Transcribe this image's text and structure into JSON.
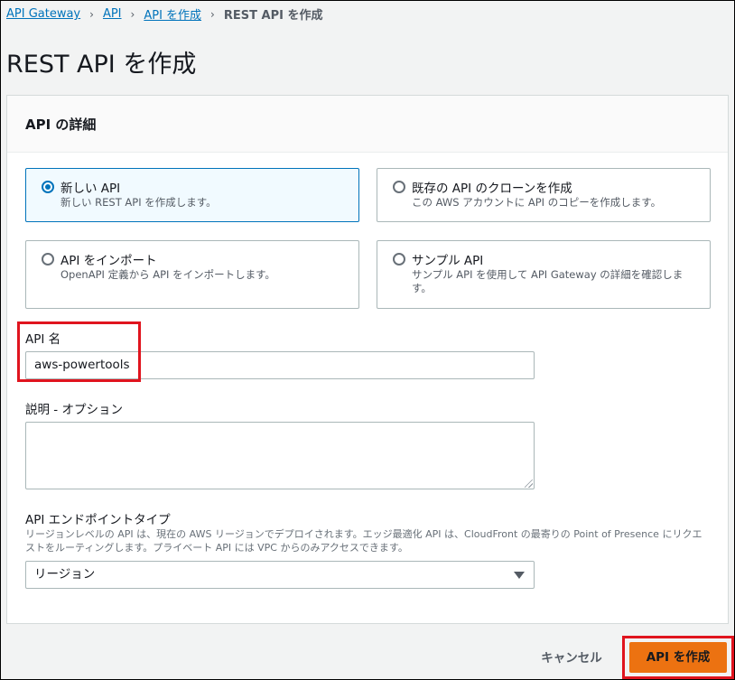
{
  "breadcrumb": {
    "items": [
      "API Gateway",
      "API",
      "API を作成"
    ],
    "current": "REST API を作成",
    "separator": "›"
  },
  "page_title": "REST API を作成",
  "panel": {
    "title": "API の詳細"
  },
  "options": [
    {
      "title": "新しい API",
      "description": "新しい REST API を作成します。",
      "selected": true
    },
    {
      "title": "既存の API のクローンを作成",
      "description": "この AWS アカウントに API のコピーを作成します。",
      "selected": false
    },
    {
      "title": "API をインポート",
      "description": "OpenAPI 定義から API をインポートします。",
      "selected": false
    },
    {
      "title": "サンプル API",
      "description": "サンプル API を使用して API Gateway の詳細を確認します。",
      "selected": false
    }
  ],
  "api_name": {
    "label": "API 名",
    "value": "aws-powertools"
  },
  "description_field": {
    "label": "説明 - オプション",
    "value": ""
  },
  "endpoint_type": {
    "label": "API エンドポイントタイプ",
    "description": "リージョンレベルの API は、現在の AWS リージョンでデプロイされます。エッジ最適化 API は、CloudFront の最寄りの Point of Presence にリクエストをルーティングします。プライベート API には VPC からのみアクセスできます。",
    "selected": "リージョン"
  },
  "actions": {
    "cancel": "キャンセル",
    "create": "API を作成"
  },
  "colors": {
    "link": "#0073bb",
    "primary_button": "#ec7211",
    "highlight": "#e0141e",
    "selected_tile_bg": "#f1faff"
  },
  "icons": {
    "radio": "radio-button",
    "caret": "caret-down-icon",
    "separator": "chevron-right-icon"
  }
}
